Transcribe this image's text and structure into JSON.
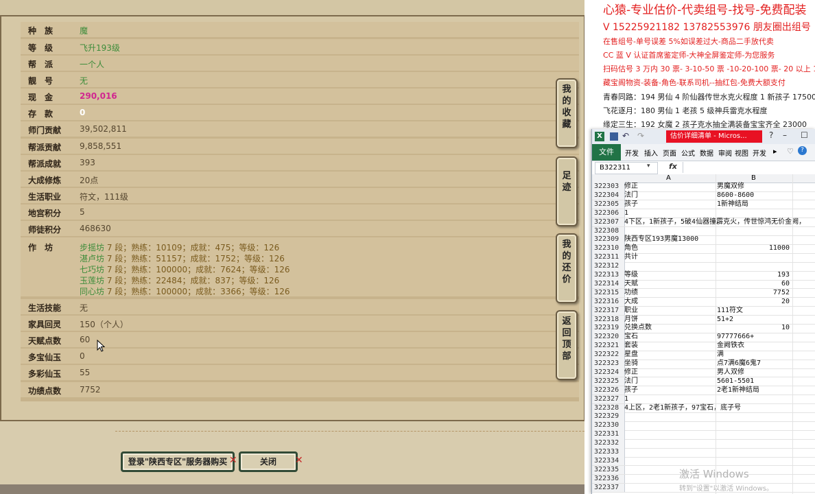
{
  "game": {
    "rows": [
      {
        "label": "种　族",
        "value": "魔",
        "style": "green"
      },
      {
        "label": "等　级",
        "value": "飞升193级",
        "style": "green"
      },
      {
        "label": "帮　派",
        "value": "一个人",
        "style": "green"
      },
      {
        "label": "靓　号",
        "value": "无",
        "style": "green"
      },
      {
        "label": "现　金",
        "value": "290,016",
        "style": "pink"
      },
      {
        "label": "存　款",
        "value": "0",
        "style": "white"
      },
      {
        "label": "师门贡献",
        "value": "39,502,811",
        "style": "dark"
      },
      {
        "label": "帮派贡献",
        "value": "9,858,551",
        "style": "dark"
      },
      {
        "label": "帮派成就",
        "value": "393",
        "style": "dark"
      },
      {
        "label": "大成修炼",
        "value": "20点",
        "style": "dark"
      },
      {
        "label": "生活职业",
        "value": "符文，111级",
        "style": "dark"
      },
      {
        "label": "地宫积分",
        "value": "5",
        "style": "dark"
      },
      {
        "label": "师徒积分",
        "value": "468630",
        "style": "dark"
      }
    ],
    "craft_label": "作　坊",
    "crafts": [
      {
        "name": "步摇坊",
        "text": " 7 段；熟练：10109；成就：475；等级：126"
      },
      {
        "name": "湛卢坊",
        "text": " 7 段；熟练：51157；成就：1752；等级：126"
      },
      {
        "name": "七巧坊",
        "text": " 7 段；熟练：100000；成就：7624；等级：126"
      },
      {
        "name": "玉莲坊",
        "text": " 7 段；熟练：22484；成就：837；等级：126"
      },
      {
        "name": "同心坊",
        "text": " 7 段；熟练：100000；成就：3366；等级：126"
      }
    ],
    "rows2": [
      {
        "label": "生活技能",
        "value": "无"
      },
      {
        "label": "家具回灵",
        "value": "150（个人）"
      },
      {
        "label": "天赋点数",
        "value": "60"
      },
      {
        "label": "多宝仙玉",
        "value": "0"
      },
      {
        "label": "多彩仙玉",
        "value": "55"
      },
      {
        "label": "功绩点数",
        "value": "7752"
      }
    ],
    "tabs": [
      {
        "label": "我的收藏"
      },
      {
        "label": "足迹"
      },
      {
        "label": "我的还价"
      },
      {
        "label": "返回顶部"
      }
    ],
    "buttons": {
      "login": "登录\"陕西专区\"服务器购买",
      "close": "关闭"
    }
  },
  "doc": {
    "lines": [
      {
        "text": "心猿-专业估价-代卖组号-找号-免费配装",
        "color": "red",
        "size": "big"
      },
      {
        "text": "V 15225921182   13782553976 朋友圈出组号",
        "color": "red",
        "size": "mid"
      },
      {
        "text": "在售组号-单号误差 5%如误差过大-商品二手放代卖",
        "color": "red",
        "size": "small"
      },
      {
        "text": "CC 蓝 V 认证首席鉴定师-大神全屏鉴定师-为您服务",
        "color": "red",
        "size": "small"
      },
      {
        "text": "扫码估号 3 万内 30 票- 3-10-50 票  -10-20-100 票- 20 以上 150+",
        "color": "red",
        "size": "small"
      },
      {
        "text": "藏宝阁物资-装备-角色-联系司机--抽红包-免费大额支付",
        "color": "red",
        "size": "small"
      },
      {
        "text": "青春同路：194 男仙 4 阶仙器传世水克火程度 1 新孩子 17500",
        "color": "black",
        "size": "small"
      },
      {
        "text": "飞花逐月：180 男仙 1 老孩 5 级神兵雷克水程度",
        "color": "black",
        "size": "small"
      },
      {
        "text": "缘定三生：192 女魔 2 孩子克水抽全满装备宝宝齐全 23000",
        "color": "black",
        "size": "small"
      }
    ]
  },
  "excel": {
    "title": "估价详细清单 - Micros...",
    "ribbon_tabs": [
      "文件",
      "开发",
      "插入",
      "页面",
      "公式",
      "数据",
      "审阅",
      "视图",
      "开发"
    ],
    "name_box": "B322311",
    "fx": "fx",
    "col_a": "A",
    "col_b": "B",
    "rows": [
      {
        "n": "322303",
        "a": "修正",
        "b": "男魔双修",
        "num": false
      },
      {
        "n": "322304",
        "a": "法门",
        "b": "8600-8600",
        "num": false
      },
      {
        "n": "322305",
        "a": "孩子",
        "b": "1新神结局",
        "num": false
      },
      {
        "n": "322306",
        "a": "                1",
        "b": "",
        "num": false
      },
      {
        "n": "322307",
        "a": "4下区，1新孩子，5破4仙器撞霹克火，传世惊鸿无价金阙，",
        "b": "",
        "num": false
      },
      {
        "n": "322308",
        "a": "",
        "b": "",
        "num": false
      },
      {
        "n": "322309",
        "a": "陕西专区193男魔13000",
        "b": "",
        "num": false
      },
      {
        "n": "322310",
        "a": "角色",
        "b": "11000",
        "num": true
      },
      {
        "n": "322311",
        "a": "共计",
        "b": "",
        "num": false
      },
      {
        "n": "322312",
        "a": "",
        "b": "",
        "num": false
      },
      {
        "n": "322313",
        "a": "等级",
        "b": "193",
        "num": true
      },
      {
        "n": "322314",
        "a": "天赋",
        "b": "60",
        "num": true
      },
      {
        "n": "322315",
        "a": "功绩",
        "b": "7752",
        "num": true
      },
      {
        "n": "322316",
        "a": "大成",
        "b": "20",
        "num": true
      },
      {
        "n": "322317",
        "a": "职业",
        "b": "111符文",
        "num": false
      },
      {
        "n": "322318",
        "a": "月饼",
        "b": "51+2",
        "num": false
      },
      {
        "n": "322319",
        "a": "兑换点数",
        "b": "10",
        "num": true
      },
      {
        "n": "322320",
        "a": "宝石",
        "b": "97777666+",
        "num": false
      },
      {
        "n": "322321",
        "a": "套装",
        "b": "金阙铁衣",
        "num": false
      },
      {
        "n": "322322",
        "a": "星盘",
        "b": "满",
        "num": false
      },
      {
        "n": "322323",
        "a": "坐骑",
        "b": "点7满6魔6鬼7",
        "num": false
      },
      {
        "n": "322324",
        "a": "修正",
        "b": "男人双修",
        "num": false
      },
      {
        "n": "322325",
        "a": "法门",
        "b": "5601-5501",
        "num": false
      },
      {
        "n": "322326",
        "a": "孩子",
        "b": "2老1新神结局",
        "num": false
      },
      {
        "n": "322327",
        "a": "                1",
        "b": "",
        "num": false
      },
      {
        "n": "322328",
        "a": "4上区，2老1新孩子，97宝石，底子号",
        "b": "",
        "num": false
      },
      {
        "n": "322329",
        "a": "",
        "b": "",
        "num": false
      },
      {
        "n": "322330",
        "a": "",
        "b": "",
        "num": false
      },
      {
        "n": "322331",
        "a": "",
        "b": "",
        "num": false
      },
      {
        "n": "322332",
        "a": "",
        "b": "",
        "num": false
      },
      {
        "n": "322333",
        "a": "",
        "b": "",
        "num": false
      },
      {
        "n": "322334",
        "a": "",
        "b": "",
        "num": false
      },
      {
        "n": "322335",
        "a": "",
        "b": "",
        "num": false
      },
      {
        "n": "322336",
        "a": "",
        "b": "",
        "num": false
      },
      {
        "n": "322337",
        "a": "",
        "b": "",
        "num": false
      }
    ]
  },
  "watermark": {
    "title": "激活 Windows",
    "sub": "转到\"设置\"以激活 Windows。"
  },
  "colors": {
    "panel": "#d3c19c",
    "accent_pink": "#d1268f",
    "craft_green": "#3d8c3a",
    "doc_red": "#e32020",
    "excel_green": "#217346",
    "excel_title_red": "#e81123"
  }
}
